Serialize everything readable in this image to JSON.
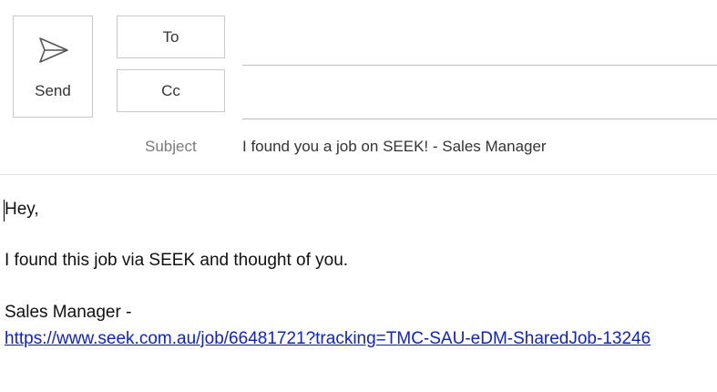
{
  "compose": {
    "send_label": "Send",
    "to_label": "To",
    "cc_label": "Cc",
    "to_value": "",
    "cc_value": "",
    "subject_label": "Subject",
    "subject_value": "I found you a job on SEEK! - Sales Manager"
  },
  "body": {
    "greeting": "Hey,",
    "intro": "I found this job via SEEK and thought of you.",
    "job_title": "Sales Manager -",
    "job_link": "https://www.seek.com.au/job/66481721?tracking=TMC-SAU-eDM-SharedJob-13246"
  },
  "icons": {
    "send": "send-paper-plane-icon"
  },
  "colors": {
    "link": "#0b1fd6",
    "border": "#c8c8c8",
    "subject_label": "#7a7a7a"
  }
}
